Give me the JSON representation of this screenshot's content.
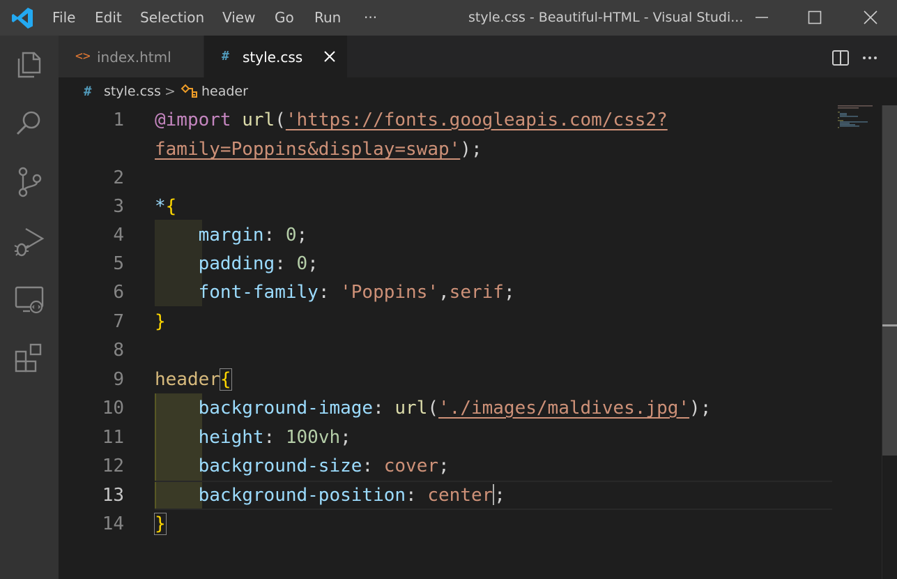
{
  "window": {
    "title": "style.css - Beautiful-HTML - Visual Studi...",
    "menu": [
      "File",
      "Edit",
      "Selection",
      "View",
      "Go",
      "Run",
      "···"
    ]
  },
  "activity_bar": {
    "items": [
      "explorer-icon",
      "search-icon",
      "source-control-icon",
      "run-debug-icon",
      "remote-explorer-icon",
      "extensions-icon"
    ]
  },
  "tabs": [
    {
      "icon": "<>",
      "label": "index.html",
      "active": false
    },
    {
      "icon": "#",
      "label": "style.css",
      "active": true
    }
  ],
  "breadcrumb": {
    "file_icon": "#",
    "file": "style.css",
    "separator": ">",
    "symbol": "header"
  },
  "editor": {
    "line_numbers": [
      "1",
      "",
      "2",
      "3",
      "4",
      "5",
      "6",
      "7",
      "8",
      "9",
      "10",
      "11",
      "12",
      "13",
      "14"
    ],
    "current_line": "13",
    "code": {
      "l1a_kw": "@import",
      "l1a_fn": "url",
      "l1a_p": "(",
      "l1a_str": "'https://fonts.googleapis.com/css2?",
      "l1b_str": "family=Poppins&display=swap'",
      "l1b_p": ");",
      "l3_sel": "*",
      "l3_br": "{",
      "l4_prop": "margin",
      "l4_c": ": ",
      "l4_val": "0",
      "l4_s": ";",
      "l5_prop": "padding",
      "l5_c": ": ",
      "l5_val": "0",
      "l5_s": ";",
      "l6_prop": "font-family",
      "l6_c": ": ",
      "l6_val1": "'Poppins'",
      "l6_comma": ",",
      "l6_val2": "serif",
      "l6_s": ";",
      "l7_br": "}",
      "l9_sel": "header",
      "l9_br": "{",
      "l10_prop": "background-image",
      "l10_c": ": ",
      "l10_fn": "url",
      "l10_p1": "(",
      "l10_str": "'./images/maldives.jpg'",
      "l10_p2": ");",
      "l11_prop": "height",
      "l11_c": ": ",
      "l11_val": "100vh",
      "l11_s": ";",
      "l12_prop": "background-size",
      "l12_c": ": ",
      "l12_val": "cover",
      "l12_s": ";",
      "l13_prop": "background-position",
      "l13_c": ": ",
      "l13_val": "center",
      "l13_s": ";",
      "l14_br": "}"
    }
  },
  "colors": {
    "keyword": "#c586c0",
    "function": "#dcdcaa",
    "string": "#ce9178",
    "selector": "#d7ba7d",
    "bracket": "#ffd700",
    "property": "#9cdcfe",
    "number": "#b5cea8",
    "accent": "#007acc"
  }
}
